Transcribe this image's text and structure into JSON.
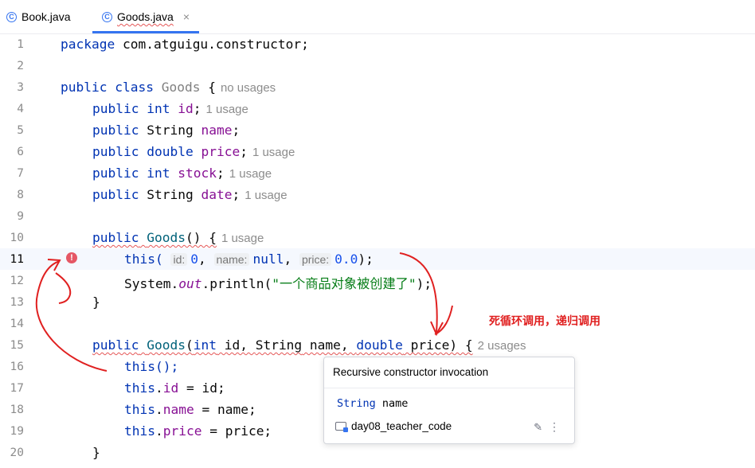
{
  "tabs": [
    {
      "label": "Book.java",
      "icon": "class-icon",
      "active": false
    },
    {
      "label": "Goods.java",
      "icon": "class-icon",
      "active": true
    }
  ],
  "tab_close_glyph": "×",
  "class_icon_glyph": "C",
  "line_numbers": [
    "1",
    "2",
    "3",
    "4",
    "5",
    "6",
    "7",
    "8",
    "9",
    "10",
    "11",
    "12",
    "13",
    "14",
    "15",
    "16",
    "17",
    "18",
    "19",
    "20"
  ],
  "code": {
    "l1_a": "package",
    "l1_b": " com.atguigu.constructor;",
    "public": "public",
    "class": "class",
    "class_name": "Goods",
    "brace_open": " {",
    "hint_no_usages": "no usages",
    "hint_1_usage": "1 usage",
    "hint_2_usages": "2 usages",
    "int": "int",
    "double": "double",
    "string": "String",
    "f_id": "id",
    "f_name": "name",
    "f_price": "price",
    "f_stock": "stock",
    "f_date": "date",
    "semi": ";",
    "ctor1": "Goods",
    "parens_open": "() {",
    "this_open": "this(",
    "inlay_id": "id:",
    "val_0": "0",
    "comma": ", ",
    "inlay_name": "name:",
    "val_null": "null",
    "inlay_price": "price:",
    "val_00": "0.0",
    "close_semi": ");",
    "system": "System.",
    "out": "out",
    "println_open": ".println(",
    "str_msg": "\"一个商品对象被创建了\"",
    "close_brace": "}",
    "ctor2_open": "(",
    "p_int": "int",
    "p_id": " id, ",
    "p_string": "String",
    "p_name": " name, ",
    "p_double": "double",
    "p_price": " price) {",
    "this_call": "this();",
    "this_kw": "this",
    "dot": ".",
    "assign_id": " = id;",
    "assign_name": " = name;",
    "assign_price": " = price;"
  },
  "annotation": "死循环调用，递归调用",
  "popup": {
    "title": "Recursive constructor invocation",
    "sig_type": "String",
    "sig_name": "name",
    "module": "day08_teacher_code",
    "edit_icon": "pencil-icon",
    "more_icon": "more-vertical-icon",
    "more_glyph": "⋮",
    "edit_glyph": "✎"
  },
  "colors": {
    "keyword": "#0033b3",
    "error": "#e55757",
    "annotation": "#e02020",
    "accent": "#3574f0"
  }
}
